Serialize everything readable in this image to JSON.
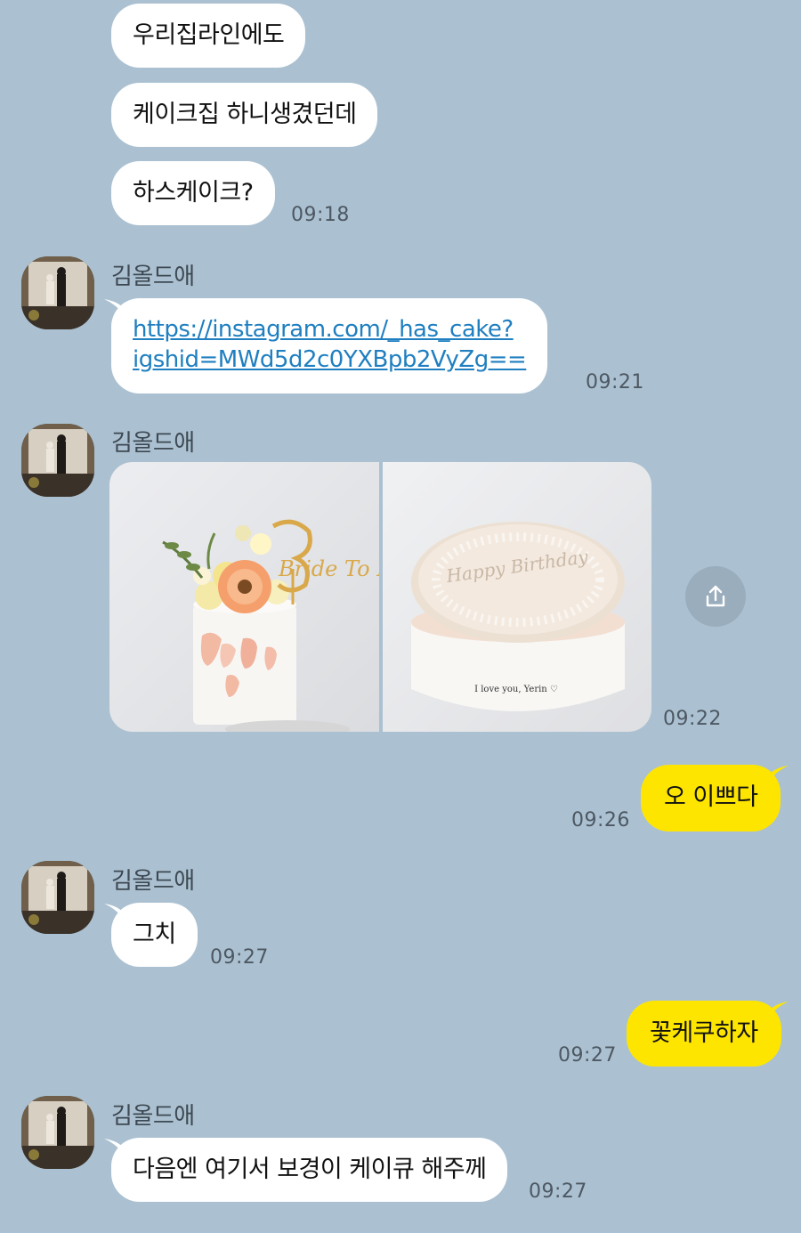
{
  "messages": {
    "m1": "우리집라인에도",
    "m2": "케이크집 하니생겼던데",
    "m3": "하스케이크?",
    "m3_time": "09:18",
    "m4_sender": "김올드애",
    "m4_line1": "https://instagram.com/_has_cake?",
    "m4_line2": "igshid=MWd5d2c0YXBpb2VyZg==",
    "m4_time": "09:21",
    "m5_sender": "김올드애",
    "m5_time": "09:22",
    "m6": "오 이쁘다",
    "m6_time": "09:26",
    "m7_sender": "김올드애",
    "m7": "그치",
    "m7_time": "09:27",
    "m8": "꽃케쿠하자",
    "m8_time": "09:27",
    "m9_sender": "김올드애",
    "m9": "다음엔 여기서 보경이 케이큐 해주께",
    "m9_time": "09:27"
  },
  "cake_photos": {
    "left_topper": "Bride To Be",
    "right_top": "Happy Birthday",
    "right_side": "I love you, Yerin ♡"
  },
  "icons": {
    "share": "share-icon"
  },
  "colors": {
    "background": "#abc1d1",
    "my_bubble": "#fee500",
    "other_bubble": "#ffffff",
    "link": "#1f7fc0"
  }
}
